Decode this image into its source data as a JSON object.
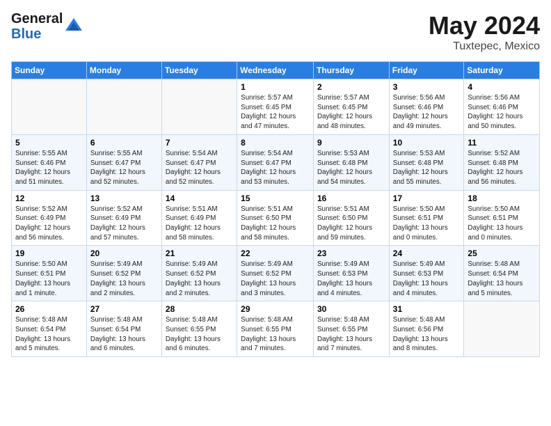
{
  "logo": {
    "general": "General",
    "blue": "Blue"
  },
  "title": {
    "month": "May 2024",
    "location": "Tuxtepec, Mexico"
  },
  "headers": [
    "Sunday",
    "Monday",
    "Tuesday",
    "Wednesday",
    "Thursday",
    "Friday",
    "Saturday"
  ],
  "weeks": [
    [
      {
        "day": "",
        "info": ""
      },
      {
        "day": "",
        "info": ""
      },
      {
        "day": "",
        "info": ""
      },
      {
        "day": "1",
        "info": "Sunrise: 5:57 AM\nSunset: 6:45 PM\nDaylight: 12 hours\nand 47 minutes."
      },
      {
        "day": "2",
        "info": "Sunrise: 5:57 AM\nSunset: 6:45 PM\nDaylight: 12 hours\nand 48 minutes."
      },
      {
        "day": "3",
        "info": "Sunrise: 5:56 AM\nSunset: 6:46 PM\nDaylight: 12 hours\nand 49 minutes."
      },
      {
        "day": "4",
        "info": "Sunrise: 5:56 AM\nSunset: 6:46 PM\nDaylight: 12 hours\nand 50 minutes."
      }
    ],
    [
      {
        "day": "5",
        "info": "Sunrise: 5:55 AM\nSunset: 6:46 PM\nDaylight: 12 hours\nand 51 minutes."
      },
      {
        "day": "6",
        "info": "Sunrise: 5:55 AM\nSunset: 6:47 PM\nDaylight: 12 hours\nand 52 minutes."
      },
      {
        "day": "7",
        "info": "Sunrise: 5:54 AM\nSunset: 6:47 PM\nDaylight: 12 hours\nand 52 minutes."
      },
      {
        "day": "8",
        "info": "Sunrise: 5:54 AM\nSunset: 6:47 PM\nDaylight: 12 hours\nand 53 minutes."
      },
      {
        "day": "9",
        "info": "Sunrise: 5:53 AM\nSunset: 6:48 PM\nDaylight: 12 hours\nand 54 minutes."
      },
      {
        "day": "10",
        "info": "Sunrise: 5:53 AM\nSunset: 6:48 PM\nDaylight: 12 hours\nand 55 minutes."
      },
      {
        "day": "11",
        "info": "Sunrise: 5:52 AM\nSunset: 6:48 PM\nDaylight: 12 hours\nand 56 minutes."
      }
    ],
    [
      {
        "day": "12",
        "info": "Sunrise: 5:52 AM\nSunset: 6:49 PM\nDaylight: 12 hours\nand 56 minutes."
      },
      {
        "day": "13",
        "info": "Sunrise: 5:52 AM\nSunset: 6:49 PM\nDaylight: 12 hours\nand 57 minutes."
      },
      {
        "day": "14",
        "info": "Sunrise: 5:51 AM\nSunset: 6:49 PM\nDaylight: 12 hours\nand 58 minutes."
      },
      {
        "day": "15",
        "info": "Sunrise: 5:51 AM\nSunset: 6:50 PM\nDaylight: 12 hours\nand 58 minutes."
      },
      {
        "day": "16",
        "info": "Sunrise: 5:51 AM\nSunset: 6:50 PM\nDaylight: 12 hours\nand 59 minutes."
      },
      {
        "day": "17",
        "info": "Sunrise: 5:50 AM\nSunset: 6:51 PM\nDaylight: 13 hours\nand 0 minutes."
      },
      {
        "day": "18",
        "info": "Sunrise: 5:50 AM\nSunset: 6:51 PM\nDaylight: 13 hours\nand 0 minutes."
      }
    ],
    [
      {
        "day": "19",
        "info": "Sunrise: 5:50 AM\nSunset: 6:51 PM\nDaylight: 13 hours\nand 1 minute."
      },
      {
        "day": "20",
        "info": "Sunrise: 5:49 AM\nSunset: 6:52 PM\nDaylight: 13 hours\nand 2 minutes."
      },
      {
        "day": "21",
        "info": "Sunrise: 5:49 AM\nSunset: 6:52 PM\nDaylight: 13 hours\nand 2 minutes."
      },
      {
        "day": "22",
        "info": "Sunrise: 5:49 AM\nSunset: 6:52 PM\nDaylight: 13 hours\nand 3 minutes."
      },
      {
        "day": "23",
        "info": "Sunrise: 5:49 AM\nSunset: 6:53 PM\nDaylight: 13 hours\nand 4 minutes."
      },
      {
        "day": "24",
        "info": "Sunrise: 5:49 AM\nSunset: 6:53 PM\nDaylight: 13 hours\nand 4 minutes."
      },
      {
        "day": "25",
        "info": "Sunrise: 5:48 AM\nSunset: 6:54 PM\nDaylight: 13 hours\nand 5 minutes."
      }
    ],
    [
      {
        "day": "26",
        "info": "Sunrise: 5:48 AM\nSunset: 6:54 PM\nDaylight: 13 hours\nand 5 minutes."
      },
      {
        "day": "27",
        "info": "Sunrise: 5:48 AM\nSunset: 6:54 PM\nDaylight: 13 hours\nand 6 minutes."
      },
      {
        "day": "28",
        "info": "Sunrise: 5:48 AM\nSunset: 6:55 PM\nDaylight: 13 hours\nand 6 minutes."
      },
      {
        "day": "29",
        "info": "Sunrise: 5:48 AM\nSunset: 6:55 PM\nDaylight: 13 hours\nand 7 minutes."
      },
      {
        "day": "30",
        "info": "Sunrise: 5:48 AM\nSunset: 6:55 PM\nDaylight: 13 hours\nand 7 minutes."
      },
      {
        "day": "31",
        "info": "Sunrise: 5:48 AM\nSunset: 6:56 PM\nDaylight: 13 hours\nand 8 minutes."
      },
      {
        "day": "",
        "info": ""
      }
    ]
  ]
}
